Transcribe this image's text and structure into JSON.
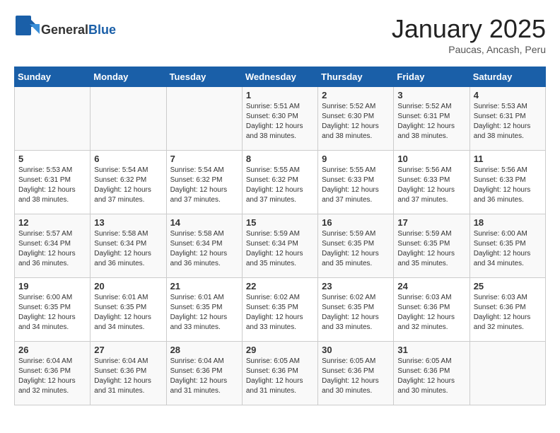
{
  "logo": {
    "general": "General",
    "blue": "Blue"
  },
  "title": "January 2025",
  "subtitle": "Paucas, Ancash, Peru",
  "days_of_week": [
    "Sunday",
    "Monday",
    "Tuesday",
    "Wednesday",
    "Thursday",
    "Friday",
    "Saturday"
  ],
  "weeks": [
    [
      {
        "day": "",
        "info": ""
      },
      {
        "day": "",
        "info": ""
      },
      {
        "day": "",
        "info": ""
      },
      {
        "day": "1",
        "info": "Sunrise: 5:51 AM\nSunset: 6:30 PM\nDaylight: 12 hours\nand 38 minutes."
      },
      {
        "day": "2",
        "info": "Sunrise: 5:52 AM\nSunset: 6:30 PM\nDaylight: 12 hours\nand 38 minutes."
      },
      {
        "day": "3",
        "info": "Sunrise: 5:52 AM\nSunset: 6:31 PM\nDaylight: 12 hours\nand 38 minutes."
      },
      {
        "day": "4",
        "info": "Sunrise: 5:53 AM\nSunset: 6:31 PM\nDaylight: 12 hours\nand 38 minutes."
      }
    ],
    [
      {
        "day": "5",
        "info": "Sunrise: 5:53 AM\nSunset: 6:31 PM\nDaylight: 12 hours\nand 38 minutes."
      },
      {
        "day": "6",
        "info": "Sunrise: 5:54 AM\nSunset: 6:32 PM\nDaylight: 12 hours\nand 37 minutes."
      },
      {
        "day": "7",
        "info": "Sunrise: 5:54 AM\nSunset: 6:32 PM\nDaylight: 12 hours\nand 37 minutes."
      },
      {
        "day": "8",
        "info": "Sunrise: 5:55 AM\nSunset: 6:32 PM\nDaylight: 12 hours\nand 37 minutes."
      },
      {
        "day": "9",
        "info": "Sunrise: 5:55 AM\nSunset: 6:33 PM\nDaylight: 12 hours\nand 37 minutes."
      },
      {
        "day": "10",
        "info": "Sunrise: 5:56 AM\nSunset: 6:33 PM\nDaylight: 12 hours\nand 37 minutes."
      },
      {
        "day": "11",
        "info": "Sunrise: 5:56 AM\nSunset: 6:33 PM\nDaylight: 12 hours\nand 36 minutes."
      }
    ],
    [
      {
        "day": "12",
        "info": "Sunrise: 5:57 AM\nSunset: 6:34 PM\nDaylight: 12 hours\nand 36 minutes."
      },
      {
        "day": "13",
        "info": "Sunrise: 5:58 AM\nSunset: 6:34 PM\nDaylight: 12 hours\nand 36 minutes."
      },
      {
        "day": "14",
        "info": "Sunrise: 5:58 AM\nSunset: 6:34 PM\nDaylight: 12 hours\nand 36 minutes."
      },
      {
        "day": "15",
        "info": "Sunrise: 5:59 AM\nSunset: 6:34 PM\nDaylight: 12 hours\nand 35 minutes."
      },
      {
        "day": "16",
        "info": "Sunrise: 5:59 AM\nSunset: 6:35 PM\nDaylight: 12 hours\nand 35 minutes."
      },
      {
        "day": "17",
        "info": "Sunrise: 5:59 AM\nSunset: 6:35 PM\nDaylight: 12 hours\nand 35 minutes."
      },
      {
        "day": "18",
        "info": "Sunrise: 6:00 AM\nSunset: 6:35 PM\nDaylight: 12 hours\nand 34 minutes."
      }
    ],
    [
      {
        "day": "19",
        "info": "Sunrise: 6:00 AM\nSunset: 6:35 PM\nDaylight: 12 hours\nand 34 minutes."
      },
      {
        "day": "20",
        "info": "Sunrise: 6:01 AM\nSunset: 6:35 PM\nDaylight: 12 hours\nand 34 minutes."
      },
      {
        "day": "21",
        "info": "Sunrise: 6:01 AM\nSunset: 6:35 PM\nDaylight: 12 hours\nand 33 minutes."
      },
      {
        "day": "22",
        "info": "Sunrise: 6:02 AM\nSunset: 6:35 PM\nDaylight: 12 hours\nand 33 minutes."
      },
      {
        "day": "23",
        "info": "Sunrise: 6:02 AM\nSunset: 6:35 PM\nDaylight: 12 hours\nand 33 minutes."
      },
      {
        "day": "24",
        "info": "Sunrise: 6:03 AM\nSunset: 6:36 PM\nDaylight: 12 hours\nand 32 minutes."
      },
      {
        "day": "25",
        "info": "Sunrise: 6:03 AM\nSunset: 6:36 PM\nDaylight: 12 hours\nand 32 minutes."
      }
    ],
    [
      {
        "day": "26",
        "info": "Sunrise: 6:04 AM\nSunset: 6:36 PM\nDaylight: 12 hours\nand 32 minutes."
      },
      {
        "day": "27",
        "info": "Sunrise: 6:04 AM\nSunset: 6:36 PM\nDaylight: 12 hours\nand 31 minutes."
      },
      {
        "day": "28",
        "info": "Sunrise: 6:04 AM\nSunset: 6:36 PM\nDaylight: 12 hours\nand 31 minutes."
      },
      {
        "day": "29",
        "info": "Sunrise: 6:05 AM\nSunset: 6:36 PM\nDaylight: 12 hours\nand 31 minutes."
      },
      {
        "day": "30",
        "info": "Sunrise: 6:05 AM\nSunset: 6:36 PM\nDaylight: 12 hours\nand 30 minutes."
      },
      {
        "day": "31",
        "info": "Sunrise: 6:05 AM\nSunset: 6:36 PM\nDaylight: 12 hours\nand 30 minutes."
      },
      {
        "day": "",
        "info": ""
      }
    ]
  ]
}
